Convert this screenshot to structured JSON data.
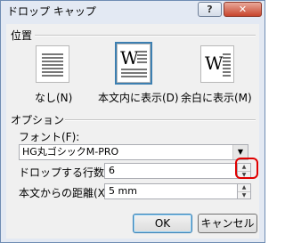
{
  "window": {
    "title": "ドロップ キャップ",
    "help_label": "?",
    "close_label": "✕"
  },
  "position": {
    "group_label": "位置",
    "options": [
      {
        "label": "なし(N)",
        "icon": "no-dropcap-icon"
      },
      {
        "label": "本文内に表示(D)",
        "icon": "dropped-icon",
        "letter": "W",
        "selected": true
      },
      {
        "label": "余白に表示(M)",
        "icon": "in-margin-icon",
        "letter": "W"
      }
    ]
  },
  "options_group": {
    "group_label": "オプション",
    "font_label": "フォント(F):",
    "font_value": "HG丸ゴシックM-PRO",
    "lines_label": "ドロップする行数(L):",
    "lines_value": "6",
    "distance_label": "本文からの距離(X):",
    "distance_value": "5 mm"
  },
  "buttons": {
    "ok": "OK",
    "cancel": "キャンセル"
  },
  "colors": {
    "highlight_ring": "#e00000",
    "selected_border": "#3c7fb1"
  }
}
